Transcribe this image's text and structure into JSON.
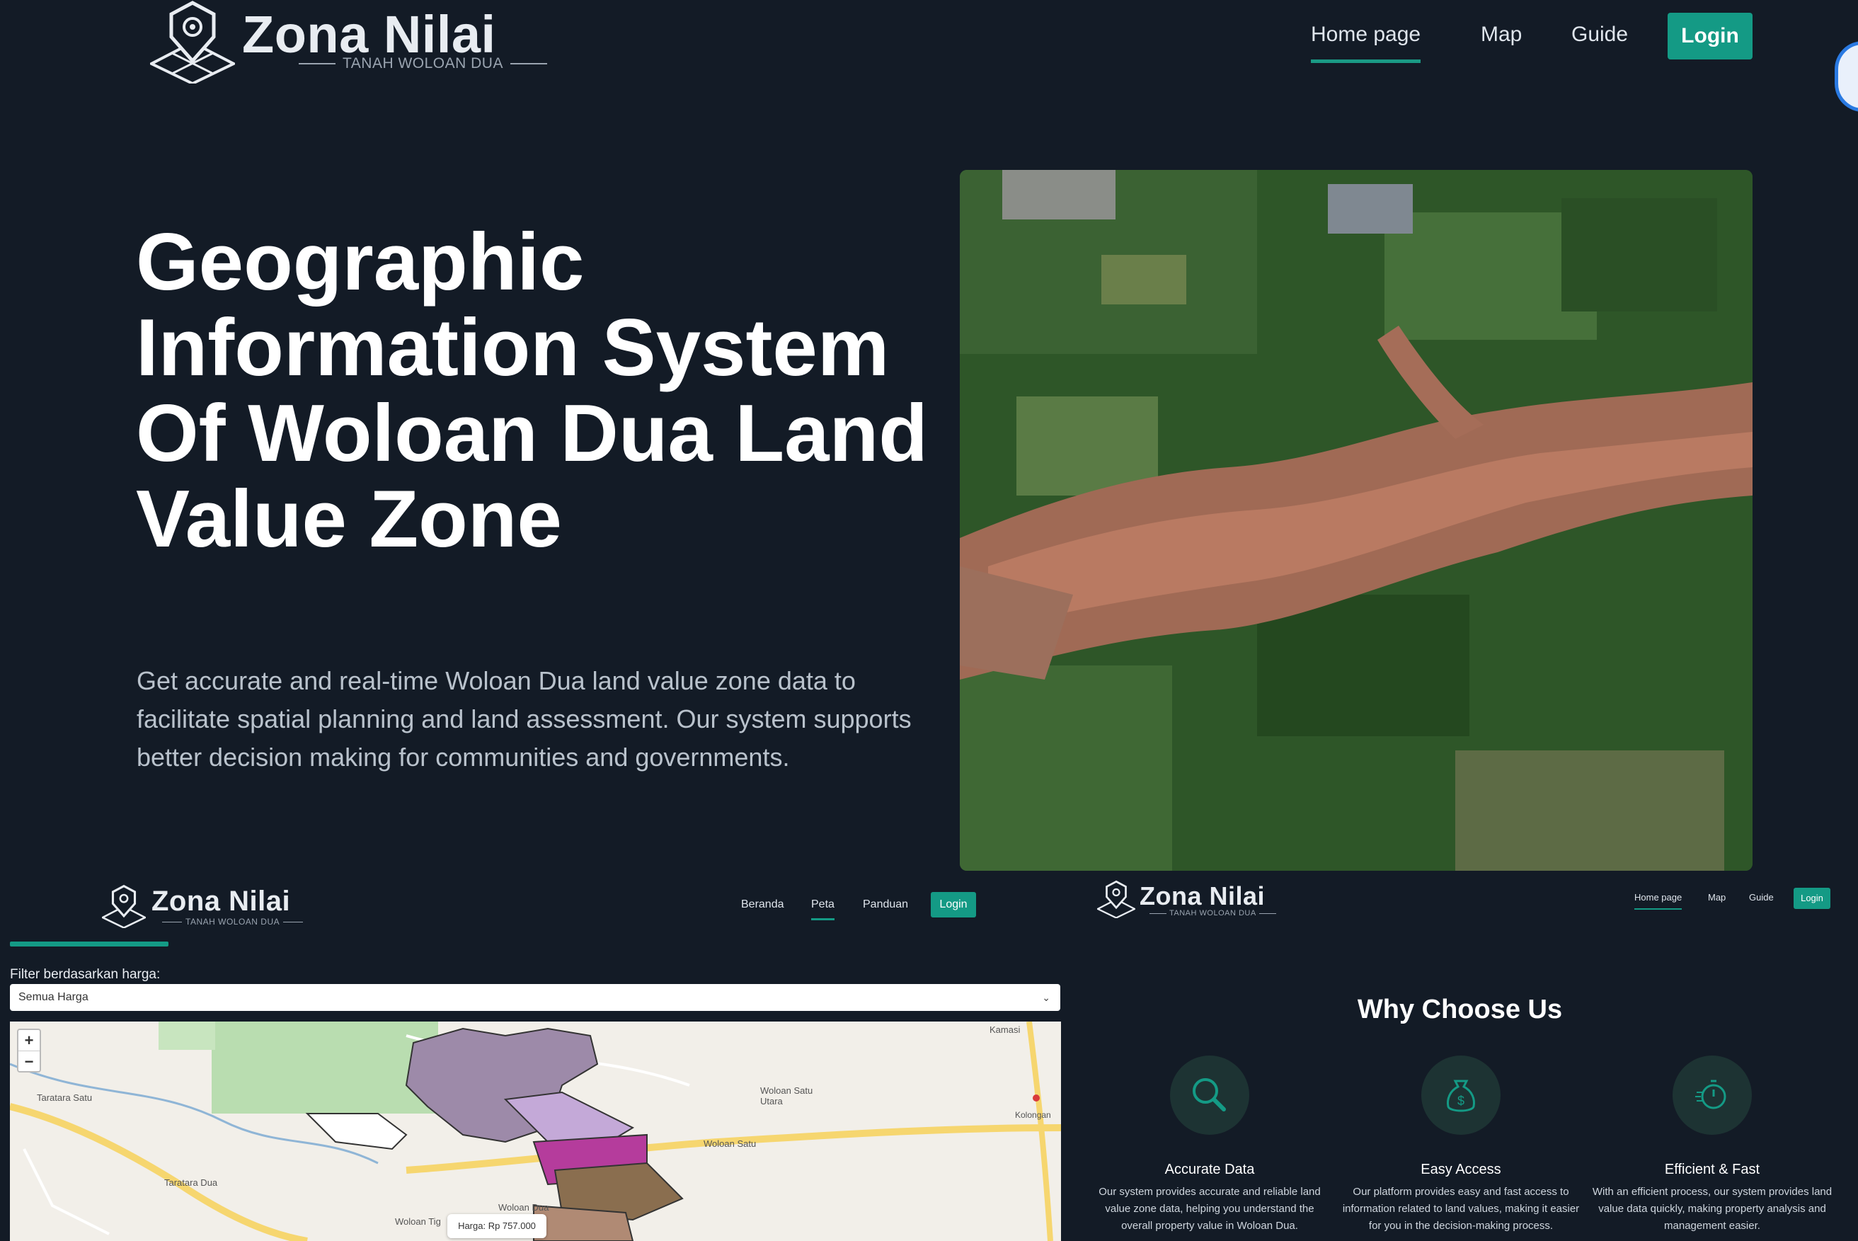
{
  "brand": {
    "name": "Zona Nilai",
    "tagline": "TANAH WOLOAN DUA"
  },
  "nav": {
    "items": [
      "Home page",
      "Map",
      "Guide"
    ],
    "active": "Home page",
    "login": "Login"
  },
  "hero": {
    "title": "Geographic Information System Of Woloan Dua Land Value Zone",
    "description": "Get accurate and real-time Woloan Dua land value zone data to facilitate spatial planning and land assessment. Our system supports better decision making for communities and governments."
  },
  "map_page": {
    "nav": {
      "items": [
        "Beranda",
        "Peta",
        "Panduan"
      ],
      "active": "Peta",
      "login": "Login"
    },
    "filter_label": "Filter berdasarkan harga:",
    "filter_value": "Semua Harga",
    "zoom_in": "+",
    "zoom_out": "−",
    "places": [
      "Kamasi",
      "Taratara Satu",
      "Taratara Dua",
      "Woloan Satu Utara",
      "Woloan Satu",
      "Kolongan",
      "Woloan Tig",
      "Woloan Dua"
    ],
    "popup": "Harga: Rp 757.000"
  },
  "why_page": {
    "nav": {
      "items": [
        "Home page",
        "Map",
        "Guide"
      ],
      "active": "Home page",
      "login": "Login"
    },
    "title": "Why Choose Us",
    "features": [
      {
        "icon": "search-icon",
        "title": "Accurate Data",
        "desc": "Our system provides accurate and reliable land value zone data, helping you understand the overall property value in Woloan Dua."
      },
      {
        "icon": "money-bag-icon",
        "title": "Easy Access",
        "desc": "Our platform provides easy and fast access to information related to land values, making it easier for you in the decision-making process."
      },
      {
        "icon": "stopwatch-icon",
        "title": "Efficient & Fast",
        "desc": "With an efficient process, our system provides land value data quickly, making property analysis and management easier."
      }
    ]
  },
  "colors": {
    "background": "#131b26",
    "accent": "#149a85"
  }
}
